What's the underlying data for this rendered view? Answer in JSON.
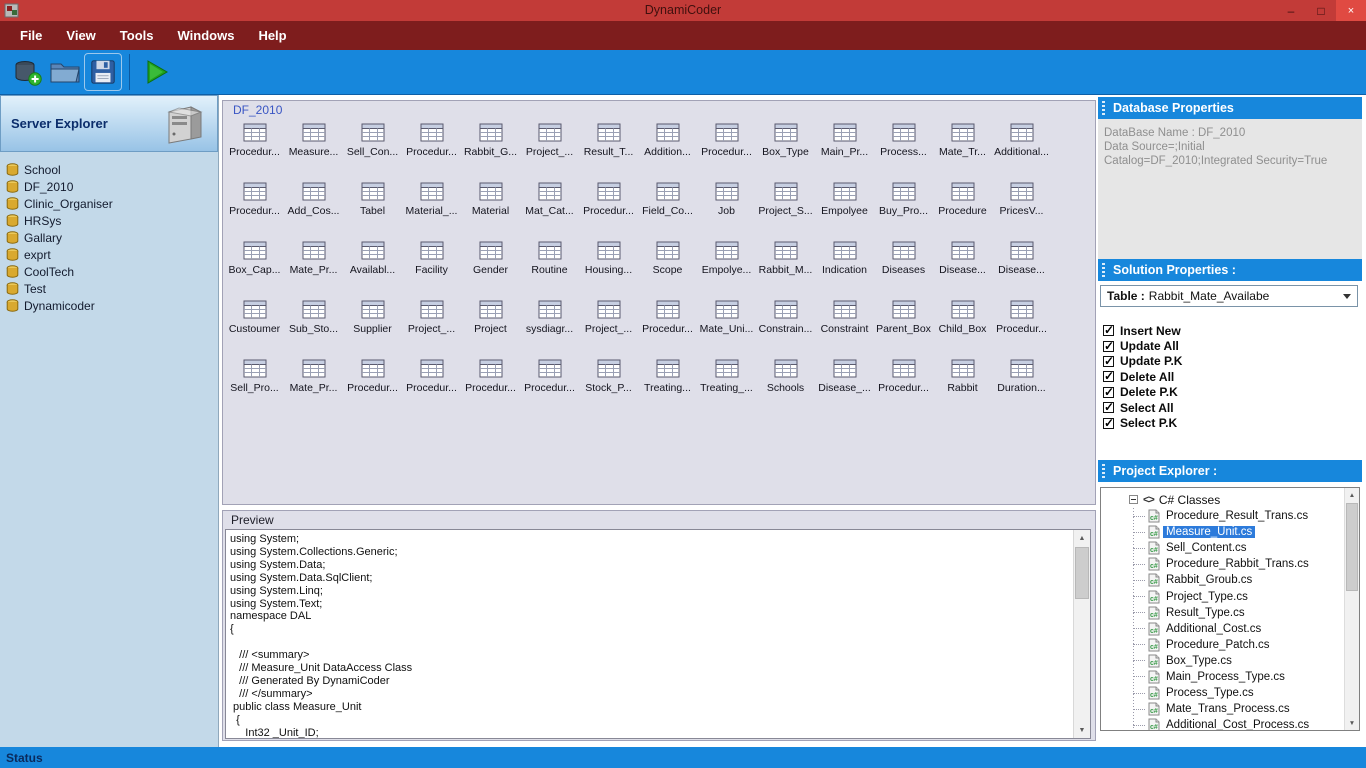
{
  "window": {
    "title": "DynamiCoder",
    "controls": {
      "minimize": "–",
      "maximize": "□",
      "close": "×"
    }
  },
  "menu": {
    "items": [
      "File",
      "View",
      "Tools",
      "Windows",
      "Help"
    ]
  },
  "toolbar": {
    "buttons": [
      "new-database",
      "open-folder",
      "save",
      "run"
    ]
  },
  "server_explorer": {
    "title": "Server Explorer",
    "databases": [
      "School",
      "DF_2010",
      "Clinic_Organiser",
      "HRSys",
      "Gallary",
      "exprt",
      "CoolTech",
      "Test",
      "Dynamicoder"
    ]
  },
  "tables_panel": {
    "group_title": "DF_2010",
    "tables": [
      "Procedur...",
      "Measure...",
      "Sell_Con...",
      "Procedur...",
      "Rabbit_G...",
      "Project_...",
      "Result_T...",
      "Addition...",
      "Procedur...",
      "Box_Type",
      "Main_Pr...",
      "Process...",
      "Mate_Tr...",
      "Additional...",
      "Procedur...",
      "Add_Cos...",
      "Tabel",
      "Material_...",
      "Material",
      "Mat_Cat...",
      "Procedur...",
      "Field_Co...",
      "Job",
      "Project_S...",
      "Empolyee",
      "Buy_Pro...",
      "Procedure",
      "PricesV...",
      "Box_Cap...",
      "Mate_Pr...",
      "Availabl...",
      "Facility",
      "Gender",
      "Routine",
      "Housing...",
      "Scope",
      "Empolye...",
      "Rabbit_M...",
      "Indication",
      "Diseases",
      "Disease...",
      "Disease...",
      "Custoumer",
      "Sub_Sto...",
      "Supplier",
      "Project_...",
      "Project",
      "sysdiagr...",
      "Project_...",
      "Procedur...",
      "Mate_Uni...",
      "Constrain...",
      "Constraint",
      "Parent_Box",
      "Child_Box",
      "Procedur...",
      "Sell_Pro...",
      "Mate_Pr...",
      "Procedur...",
      "Procedur...",
      "Procedur...",
      "Procedur...",
      "Stock_P...",
      "Treating...",
      "Treating_...",
      "Schools",
      "Disease_...",
      "Procedur...",
      "Rabbit",
      "Duration..."
    ]
  },
  "preview": {
    "title": "Preview",
    "code": "using System;\nusing System.Collections.Generic;\nusing System.Data;\nusing System.Data.SqlClient;\nusing System.Linq;\nusing System.Text;\nnamespace DAL\n{\n\n   /// <summary>\n   /// Measure_Unit DataAccess Class\n   /// Generated By DynamiCoder\n   /// </summary>\n public class Measure_Unit\n  {\n     Int32 _Unit_ID;"
  },
  "database_properties": {
    "title": "Database Properties",
    "name_line": "DataBase Name : DF_2010",
    "source_line": "Data Source=;Initial Catalog=DF_2010;Integrated Security=True"
  },
  "solution_properties": {
    "title": "Solution Properties :",
    "table_label": "Table :",
    "table_value": "Rabbit_Mate_Availabe",
    "options": [
      {
        "label": "Insert New",
        "checked": true
      },
      {
        "label": "Update All",
        "checked": true
      },
      {
        "label": "Update P.K",
        "checked": true
      },
      {
        "label": "Delete All",
        "checked": true
      },
      {
        "label": "Delete P.K",
        "checked": true
      },
      {
        "label": "Select All",
        "checked": true
      },
      {
        "label": "Select P.K",
        "checked": true
      }
    ]
  },
  "project_explorer": {
    "title": "Project Explorer :",
    "root_icon": "<>",
    "root_label": "C# Classes",
    "files": [
      {
        "label": "Procedure_Result_Trans.cs",
        "selected": false
      },
      {
        "label": "Measure_Unit.cs",
        "selected": true
      },
      {
        "label": "Sell_Content.cs",
        "selected": false
      },
      {
        "label": "Procedure_Rabbit_Trans.cs",
        "selected": false
      },
      {
        "label": "Rabbit_Groub.cs",
        "selected": false
      },
      {
        "label": "Project_Type.cs",
        "selected": false
      },
      {
        "label": "Result_Type.cs",
        "selected": false
      },
      {
        "label": "Additional_Cost.cs",
        "selected": false
      },
      {
        "label": "Procedure_Patch.cs",
        "selected": false
      },
      {
        "label": "Box_Type.cs",
        "selected": false
      },
      {
        "label": "Main_Process_Type.cs",
        "selected": false
      },
      {
        "label": "Process_Type.cs",
        "selected": false
      },
      {
        "label": "Mate_Trans_Process.cs",
        "selected": false
      },
      {
        "label": "Additional_Cost_Process.cs",
        "selected": false
      }
    ]
  },
  "status": {
    "text": "Status"
  },
  "colors": {
    "titlebar_red": "#C23B38",
    "menubar_maroon": "#7E1D1D",
    "accent_blue": "#1787DC",
    "sidebar_blue": "#C3D9E9",
    "selection_blue": "#2D7BDB"
  }
}
